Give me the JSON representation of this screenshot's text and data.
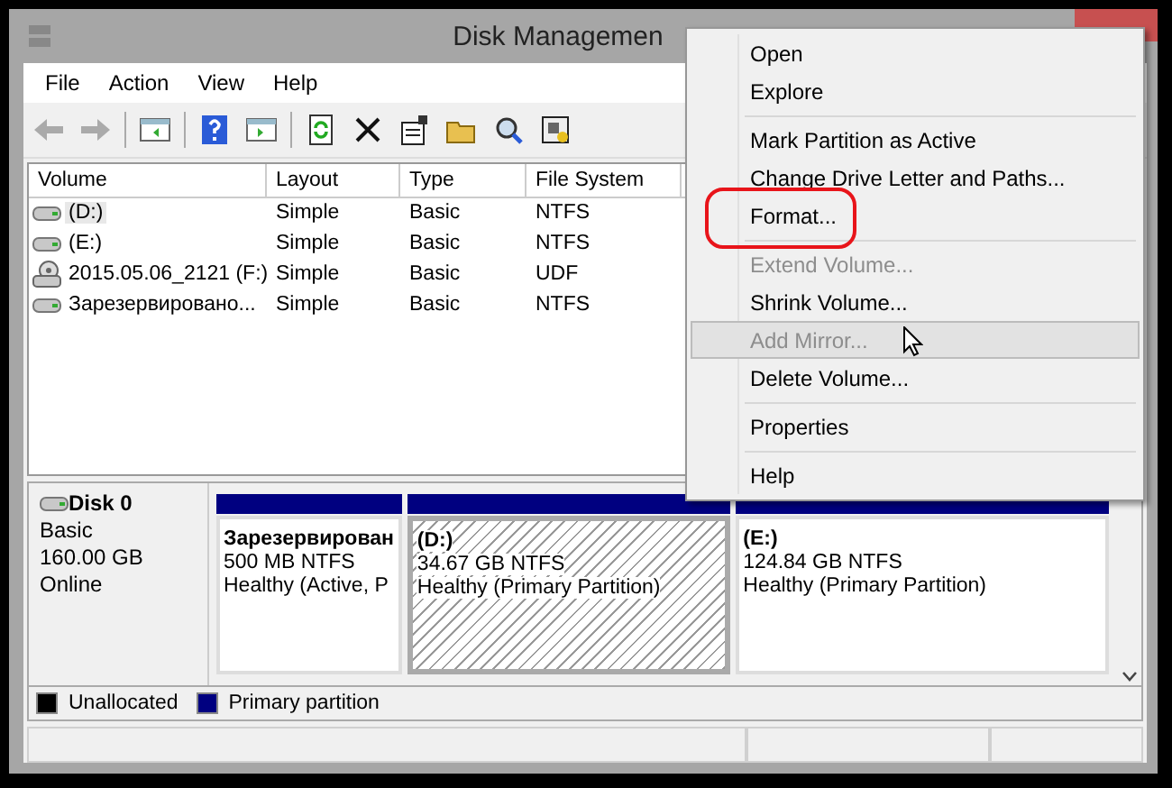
{
  "window": {
    "title": "Disk Managemen"
  },
  "menu": [
    "File",
    "Action",
    "View",
    "Help"
  ],
  "table": {
    "columns": [
      "Volume",
      "Layout",
      "Type",
      "File System"
    ],
    "rows": [
      {
        "kind": "disk",
        "selected": true,
        "cells": [
          "(D:)",
          "Simple",
          "Basic",
          "NTFS"
        ]
      },
      {
        "kind": "disk",
        "selected": false,
        "cells": [
          "(E:)",
          "Simple",
          "Basic",
          "NTFS"
        ]
      },
      {
        "kind": "optical",
        "selected": false,
        "cells": [
          "2015.05.06_2121 (F:)",
          "Simple",
          "Basic",
          "UDF"
        ]
      },
      {
        "kind": "disk",
        "selected": false,
        "cells": [
          "Зарезервировано...",
          "Simple",
          "Basic",
          "NTFS"
        ]
      }
    ]
  },
  "disk": {
    "name": "Disk 0",
    "type": "Basic",
    "size": "160.00 GB",
    "status": "Online",
    "partitions": [
      {
        "name": "Зарезервирован",
        "size": "500 MB NTFS",
        "status": "Healthy (Active, P",
        "selected": false
      },
      {
        "name": "(D:)",
        "size": "34.67 GB NTFS",
        "status": "Healthy (Primary Partition)",
        "selected": true
      },
      {
        "name": "(E:)",
        "size": "124.84 GB NTFS",
        "status": "Healthy (Primary Partition)",
        "selected": false
      }
    ]
  },
  "legend": [
    {
      "label": "Unallocated",
      "color": "#000000"
    },
    {
      "label": "Primary partition",
      "color": "#000080"
    }
  ],
  "context_menu": [
    {
      "kind": "item",
      "label": "Open",
      "disabled": false,
      "highlighted": false,
      "circled": false
    },
    {
      "kind": "item",
      "label": "Explore",
      "disabled": false,
      "highlighted": false,
      "circled": false
    },
    {
      "kind": "separator"
    },
    {
      "kind": "item",
      "label": "Mark Partition as Active",
      "disabled": false,
      "highlighted": false,
      "circled": false
    },
    {
      "kind": "item",
      "label": "Change Drive Letter and Paths...",
      "disabled": false,
      "highlighted": false,
      "circled": false
    },
    {
      "kind": "item",
      "label": "Format...",
      "disabled": false,
      "highlighted": false,
      "circled": true
    },
    {
      "kind": "separator"
    },
    {
      "kind": "item",
      "label": "Extend Volume...",
      "disabled": true,
      "highlighted": false,
      "circled": false
    },
    {
      "kind": "item",
      "label": "Shrink Volume...",
      "disabled": false,
      "highlighted": false,
      "circled": false
    },
    {
      "kind": "item",
      "label": "Add Mirror...",
      "disabled": true,
      "highlighted": true,
      "circled": false
    },
    {
      "kind": "item",
      "label": "Delete Volume...",
      "disabled": false,
      "highlighted": false,
      "circled": false
    },
    {
      "kind": "separator"
    },
    {
      "kind": "item",
      "label": "Properties",
      "disabled": false,
      "highlighted": false,
      "circled": false
    },
    {
      "kind": "separator"
    },
    {
      "kind": "item",
      "label": "Help",
      "disabled": false,
      "highlighted": false,
      "circled": false
    }
  ]
}
